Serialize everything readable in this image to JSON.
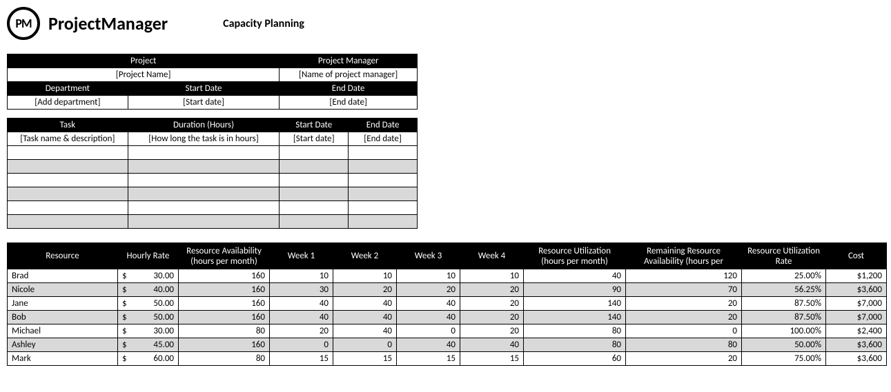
{
  "brand": {
    "logo_short": "PM",
    "logo_text": "ProjectManager"
  },
  "title": "Capacity Planning",
  "project_info": {
    "headers": {
      "project": "Project",
      "pm": "Project Manager",
      "dept": "Department",
      "start": "Start Date",
      "end": "End Date"
    },
    "values": {
      "project": "[Project Name]",
      "pm": "[Name of project manager]",
      "dept": "[Add department]",
      "start": "[Start date]",
      "end": "[End date]"
    }
  },
  "tasks": {
    "headers": {
      "task": "Task",
      "duration": "Duration (Hours)",
      "start": "Start Date",
      "end": "End Date"
    },
    "placeholder": {
      "task": "[Task name & description]",
      "duration": "[How long the task is in hours]",
      "start": "[Start date]",
      "end": "[End date]"
    }
  },
  "resources": {
    "headers": {
      "resource": "Resource",
      "rate": "Hourly Rate",
      "avail": "Resource Availability (hours per month)",
      "w1": "Week 1",
      "w2": "Week 2",
      "w3": "Week 3",
      "w4": "Week 4",
      "util": "Resource Utilization (hours per month)",
      "remain": "Remaining Resource Availability (hours per",
      "urate": "Resource Utilization Rate",
      "cost": "Cost"
    },
    "rows": [
      {
        "name": "Brad",
        "rate_sym": "$",
        "rate": "30.00",
        "avail": "160",
        "w1": "10",
        "w2": "10",
        "w3": "10",
        "w4": "10",
        "util": "40",
        "remain": "120",
        "urate": "25.00%",
        "cost": "$1,200"
      },
      {
        "name": "Nicole",
        "rate_sym": "$",
        "rate": "40.00",
        "avail": "160",
        "w1": "30",
        "w2": "20",
        "w3": "20",
        "w4": "20",
        "util": "90",
        "remain": "70",
        "urate": "56.25%",
        "cost": "$3,600"
      },
      {
        "name": "Jane",
        "rate_sym": "$",
        "rate": "50.00",
        "avail": "160",
        "w1": "40",
        "w2": "40",
        "w3": "40",
        "w4": "20",
        "util": "140",
        "remain": "20",
        "urate": "87.50%",
        "cost": "$7,000"
      },
      {
        "name": "Bob",
        "rate_sym": "$",
        "rate": "50.00",
        "avail": "160",
        "w1": "40",
        "w2": "40",
        "w3": "40",
        "w4": "20",
        "util": "140",
        "remain": "20",
        "urate": "87.50%",
        "cost": "$7,000"
      },
      {
        "name": "Michael",
        "rate_sym": "$",
        "rate": "30.00",
        "avail": "80",
        "w1": "20",
        "w2": "40",
        "w3": "0",
        "w4": "20",
        "util": "80",
        "remain": "0",
        "urate": "100.00%",
        "cost": "$2,400"
      },
      {
        "name": "Ashley",
        "rate_sym": "$",
        "rate": "45.00",
        "avail": "160",
        "w1": "0",
        "w2": "0",
        "w3": "40",
        "w4": "40",
        "util": "80",
        "remain": "80",
        "urate": "50.00%",
        "cost": "$3,600"
      },
      {
        "name": "Mark",
        "rate_sym": "$",
        "rate": "60.00",
        "avail": "80",
        "w1": "15",
        "w2": "15",
        "w3": "15",
        "w4": "15",
        "util": "60",
        "remain": "20",
        "urate": "75.00%",
        "cost": "$3,600"
      }
    ]
  }
}
